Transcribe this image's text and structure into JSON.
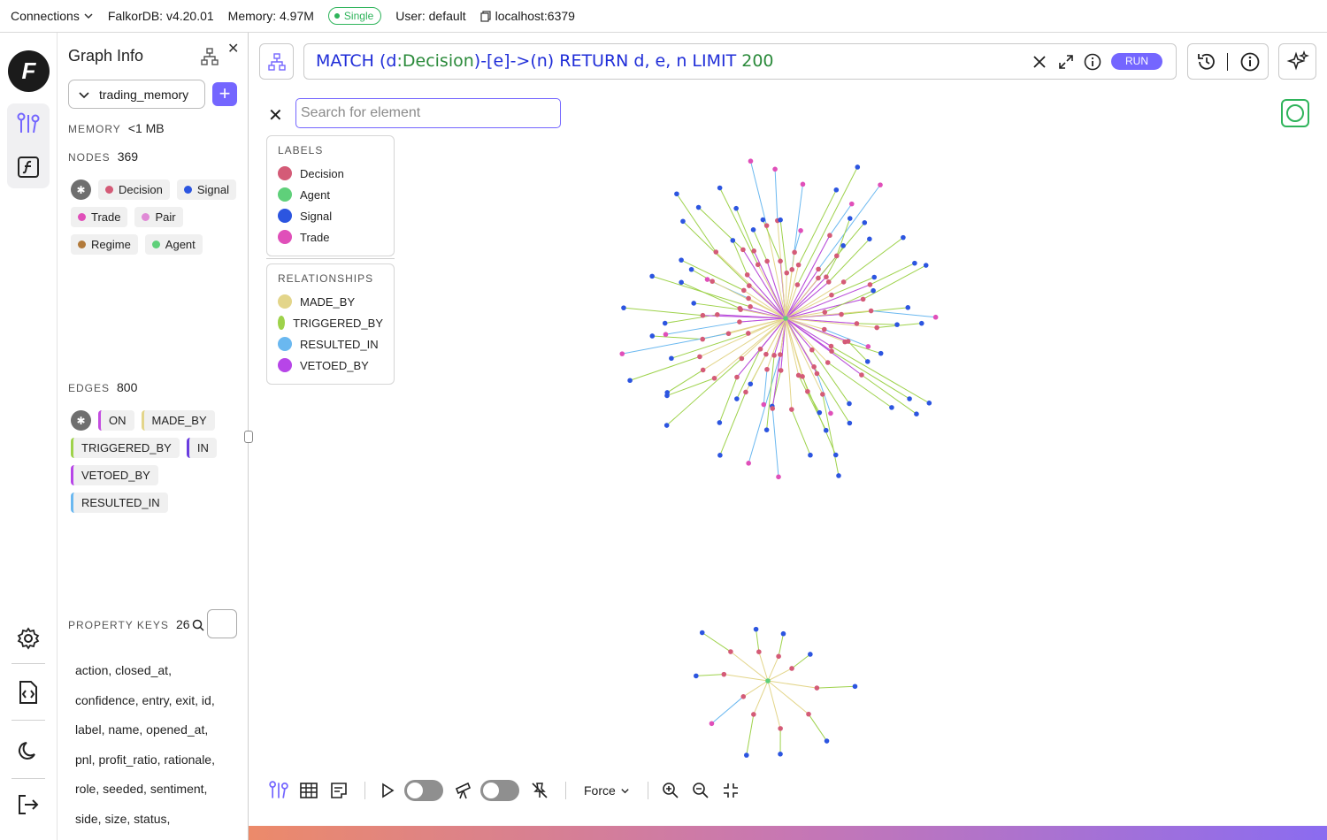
{
  "topbar": {
    "connections": "Connections",
    "version": "FalkorDB: v4.20.01",
    "memory": "Memory: 4.97M",
    "mode": "Single",
    "user": "User: default",
    "host": "localhost:6379"
  },
  "panel": {
    "title": "Graph Info",
    "graph_name": "trading_memory",
    "memory_label": "MEMORY",
    "memory_value": "<1 MB",
    "nodes_label": "NODES",
    "nodes_value": "369",
    "node_labels": [
      {
        "name": "Decision",
        "color": "#d45b77"
      },
      {
        "name": "Signal",
        "color": "#2c55e0"
      },
      {
        "name": "Trade",
        "color": "#e04fb9"
      },
      {
        "name": "Pair",
        "color": "#e08ad6"
      },
      {
        "name": "Regime",
        "color": "#b27a3a"
      },
      {
        "name": "Agent",
        "color": "#5fd07a"
      }
    ],
    "edges_label": "EDGES",
    "edges_value": "800",
    "edge_types": [
      {
        "name": "ON",
        "color": "#c34de0"
      },
      {
        "name": "MADE_BY",
        "color": "#e3d58a"
      },
      {
        "name": "TRIGGERED_BY",
        "color": "#9ed24b"
      },
      {
        "name": "IN",
        "color": "#6a3de0"
      },
      {
        "name": "VETOED_BY",
        "color": "#b745e8"
      },
      {
        "name": "RESULTED_IN",
        "color": "#6ab8f0"
      }
    ],
    "property_keys_label": "PROPERTY KEYS",
    "property_keys_value": "26",
    "property_keys_text": [
      "action, closed_at,",
      "confidence, entry, exit, id,",
      "label, name, opened_at,",
      "pnl, profit_ratio, rationale,",
      "role, seeded, sentiment,",
      "side, size, status,"
    ]
  },
  "query": {
    "run_label": "RUN"
  },
  "search": {
    "placeholder": "Search for element"
  },
  "legend": {
    "labels_header": "LABELS",
    "labels": [
      {
        "name": "Decision",
        "color": "#d45b77"
      },
      {
        "name": "Agent",
        "color": "#5fd07a"
      },
      {
        "name": "Signal",
        "color": "#2c55e0"
      },
      {
        "name": "Trade",
        "color": "#e04fb9"
      }
    ],
    "relationships_header": "RELATIONSHIPS",
    "relationships": [
      {
        "name": "MADE_BY",
        "color": "#e3d58a"
      },
      {
        "name": "TRIGGERED_BY",
        "color": "#9ed24b"
      },
      {
        "name": "RESULTED_IN",
        "color": "#6ab8f0"
      },
      {
        "name": "VETOED_BY",
        "color": "#b745e8"
      }
    ]
  },
  "toolbar": {
    "layout": "Force"
  }
}
